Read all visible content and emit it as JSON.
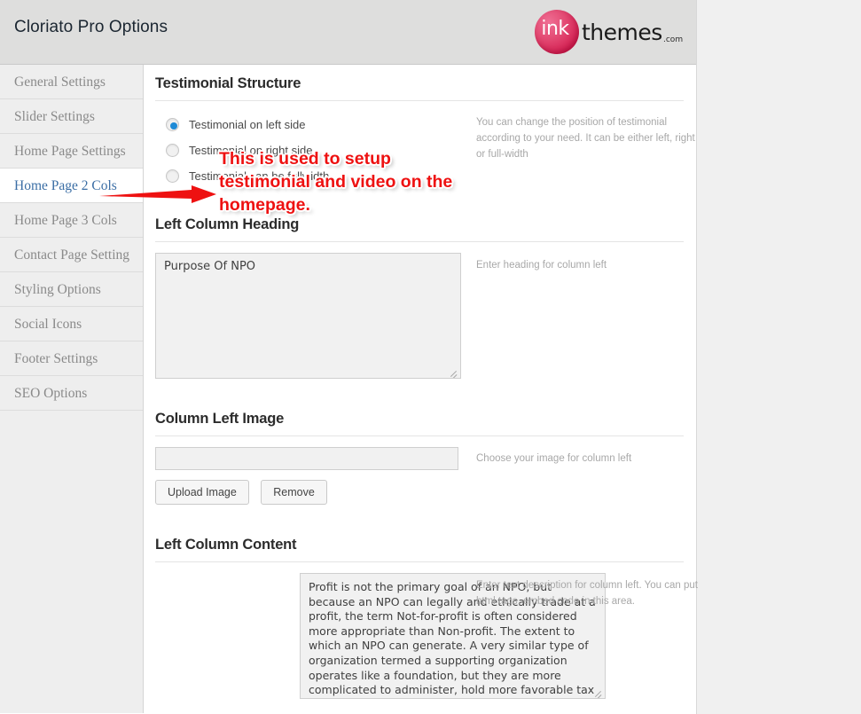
{
  "header": {
    "title": "Cloriato Pro Options",
    "logo": {
      "mark_text": "ink",
      "word": "themes",
      "tld": ".com",
      "circle_color": "#d2194d"
    }
  },
  "sidebar": {
    "items": [
      {
        "label": "General Settings",
        "active": false
      },
      {
        "label": "Slider Settings",
        "active": false
      },
      {
        "label": "Home Page Settings",
        "active": false
      },
      {
        "label": "Home Page 2 Cols",
        "active": true
      },
      {
        "label": "Home Page 3 Cols",
        "active": false
      },
      {
        "label": "Contact Page Setting",
        "active": false
      },
      {
        "label": "Styling Options",
        "active": false
      },
      {
        "label": "Social Icons",
        "active": false
      },
      {
        "label": "Footer Settings",
        "active": false
      },
      {
        "label": "SEO Options",
        "active": false
      }
    ],
    "active_text_color": "#3b6ea5"
  },
  "sections": {
    "testimonial_structure": {
      "title": "Testimonial Structure",
      "hint": "You can change the position of testimonial according to your need. It can be either left, right or full-width",
      "options": [
        {
          "label": "Testimonial on left side",
          "selected": true
        },
        {
          "label": "Testimonial on right side",
          "selected": false
        },
        {
          "label": "Testimonial can be fullwidth",
          "selected": false
        }
      ]
    },
    "left_column_heading": {
      "title": "Left Column Heading",
      "hint": "Enter heading for column left",
      "value": "Purpose Of NPO",
      "placeholder": ""
    },
    "column_left_image": {
      "title": "Column Left Image",
      "hint": "Choose your image for column left",
      "value": "",
      "placeholder": "",
      "upload_label": "Upload Image",
      "remove_label": "Remove"
    },
    "left_column_content": {
      "title": "Left Column Content",
      "hint": "Enter text description for column left. You can put html tags, embed code in this area.",
      "value": "Profit is not the primary goal of an NPO, but because an NPO can legally and ethically trade at a profit, the term Not-for-profit is often considered more appropriate than Non-profit. The extent to which an NPO can generate. A very similar type of organization termed a supporting organization operates like a foundation, but they are more complicated to administer, hold more favorable tax status.",
      "placeholder": ""
    }
  },
  "annotations": {
    "callout_text": "This is used to setup testimonial and video on the homepage.",
    "callout_color": "#ee1111",
    "arrow_color": "#ee1111"
  }
}
